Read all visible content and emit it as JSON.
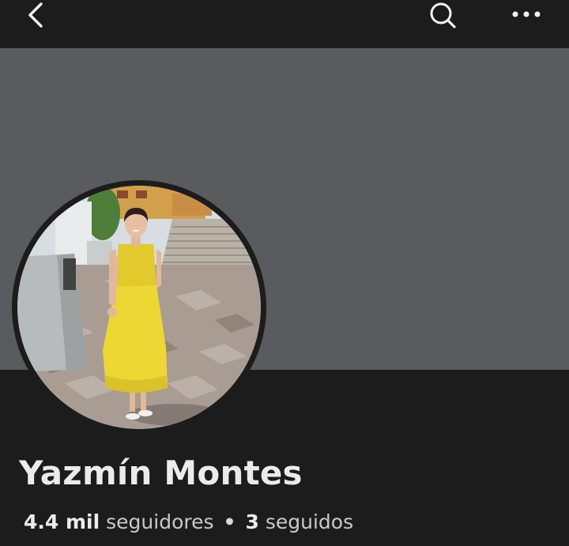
{
  "header": {
    "back_icon": "chevron-left-icon",
    "search_icon": "search-icon",
    "more_icon": "more-horizontal-icon"
  },
  "profile": {
    "name": "Yazmín Montes",
    "followers_count": "4.4 mil",
    "followers_label": "seguidores",
    "separator": "•",
    "following_count": "3",
    "following_label": "seguidos"
  },
  "colors": {
    "background": "#1c1c1d",
    "cover": "#5a5b5f",
    "text_primary": "#ebebeb",
    "text_secondary": "#c9c9c9"
  }
}
